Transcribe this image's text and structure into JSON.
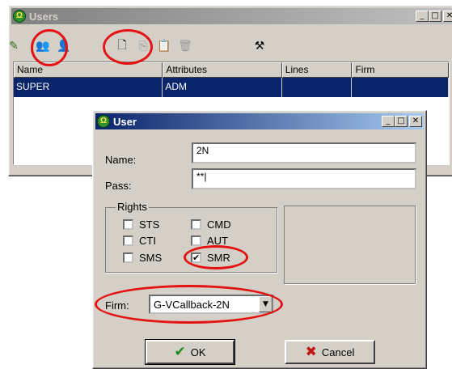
{
  "users_window": {
    "title": "Users",
    "toolbar": {
      "icons": [
        "pencil-icon",
        "users-icon",
        "user-icon",
        "new-document-icon",
        "copy-icon",
        "paste-icon",
        "trash-icon",
        "tools-icon"
      ]
    },
    "list": {
      "columns": [
        "Name",
        "Attributes",
        "Lines",
        "Firm"
      ],
      "rows": [
        {
          "name": "SUPER",
          "attributes": "ADM",
          "lines": "",
          "firm": ""
        }
      ]
    }
  },
  "user_dialog": {
    "title": "User",
    "name_label": "Name:",
    "name_value": "2N",
    "pass_label": "Pass:",
    "pass_value": "**|",
    "rights": {
      "title": "Rights",
      "items": [
        {
          "label": "STS",
          "checked": false
        },
        {
          "label": "CMD",
          "checked": false
        },
        {
          "label": "CTI",
          "checked": false
        },
        {
          "label": "AUT",
          "checked": false
        },
        {
          "label": "SMS",
          "checked": false
        },
        {
          "label": "SMR",
          "checked": true
        }
      ]
    },
    "firm_label": "Firm:",
    "firm_value": "G-VCallback-2N",
    "ok_label": "OK",
    "cancel_label": "Cancel"
  },
  "annotation_color": "#e51212",
  "accent_color": "#0a246a"
}
